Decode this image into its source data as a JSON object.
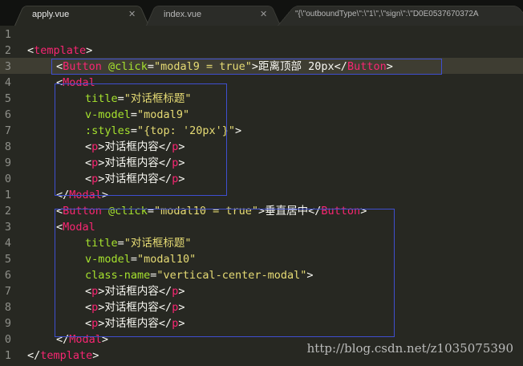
{
  "tabs": [
    {
      "label": "apply.vue",
      "close": "✕",
      "active": true
    },
    {
      "label": "index.vue",
      "close": "✕",
      "active": false
    },
    {
      "label": "\"{\\\"outboundType\\\":\\\"1\\\",\\\"sign\\\":\\\"D0E0537670372A",
      "close": "",
      "active": false
    }
  ],
  "line_numbers": [
    "1",
    "2",
    "3",
    "4",
    "5",
    "6",
    "7",
    "8",
    "9",
    "0",
    "1",
    "2",
    "3",
    "4",
    "5",
    "6",
    "7",
    "8",
    "9",
    "0",
    "1"
  ],
  "code": {
    "l2_open": "<",
    "l2_tag": "template",
    "l2_close": ">",
    "l3_open": "<",
    "l3_tag": "Button",
    "l3_attr": " @click",
    "l3_eq": "=",
    "l3_val": "\"modal9 = true\"",
    "l3_gt": ">",
    "l3_text": "距离顶部 20px",
    "l3_end_open": "</",
    "l3_end_tag": "Button",
    "l3_end_gt": ">",
    "l4_open": "<",
    "l4_tag": "Modal",
    "l5_attr": "title",
    "l5_eq": "=",
    "l5_val": "\"对话框标题\"",
    "l6_attr": "v-model",
    "l6_eq": "=",
    "l6_val": "\"modal9\"",
    "l7_attr": ":styles",
    "l7_eq": "=",
    "l7_val": "\"{top: '20px'}\"",
    "l7_gt": ">",
    "p_open": "<",
    "p_tag": "p",
    "p_gt": ">",
    "p_text": "对话框内容",
    "p_end_open": "</",
    "p_end_gt": ">",
    "l11_open": "</",
    "l11_tag": "Modal",
    "l11_gt": ">",
    "l12_open": "<",
    "l12_tag": "Button",
    "l12_attr": " @click",
    "l12_eq": "=",
    "l12_val": "\"modal10 = true\"",
    "l12_gt": ">",
    "l12_text": "垂直居中",
    "l12_end_open": "</",
    "l12_end_tag": "Button",
    "l12_end_gt": ">",
    "l13_open": "<",
    "l13_tag": "Modal",
    "l14_attr": "title",
    "l14_eq": "=",
    "l14_val": "\"对话框标题\"",
    "l15_attr": "v-model",
    "l15_eq": "=",
    "l15_val": "\"modal10\"",
    "l16_attr": "class-name",
    "l16_eq": "=",
    "l16_val": "\"vertical-center-modal\"",
    "l16_gt": ">",
    "l20_open": "</",
    "l20_tag": "Modal",
    "l20_gt": ">",
    "l21_open": "</",
    "l21_tag": "template",
    "l21_gt": ">"
  },
  "watermark": "http://blog.csdn.net/z1035075390",
  "colors": {
    "background": "#272822",
    "tag": "#f92672",
    "attr": "#a6e22e",
    "string": "#e6db74",
    "box": "#3f4fd0"
  }
}
